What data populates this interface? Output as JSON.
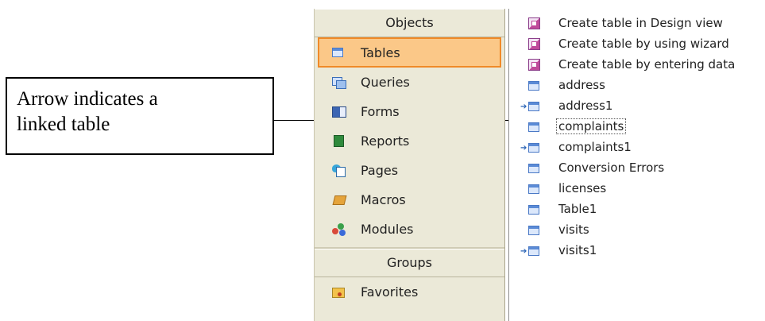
{
  "callout": {
    "line1": "Arrow indicates a",
    "line2": "linked table"
  },
  "objects_bar": {
    "objects_header": "Objects",
    "items": [
      {
        "label": "Tables",
        "icon": "table-icon",
        "selected": true
      },
      {
        "label": "Queries",
        "icon": "queries-icon"
      },
      {
        "label": "Forms",
        "icon": "forms-icon"
      },
      {
        "label": "Reports",
        "icon": "reports-icon"
      },
      {
        "label": "Pages",
        "icon": "pages-icon"
      },
      {
        "label": "Macros",
        "icon": "macros-icon"
      },
      {
        "label": "Modules",
        "icon": "modules-icon"
      }
    ],
    "groups_header": "Groups",
    "groups": [
      {
        "label": "Favorites",
        "icon": "favorites-folder-icon"
      }
    ]
  },
  "table_list": {
    "items": [
      {
        "label": "Create table in Design view",
        "icon": "wizard-icon",
        "linked": false
      },
      {
        "label": "Create table by using wizard",
        "icon": "wizard-icon",
        "linked": false
      },
      {
        "label": "Create table by entering data",
        "icon": "wizard-icon",
        "linked": false
      },
      {
        "label": "address",
        "icon": "table-icon",
        "linked": false
      },
      {
        "label": "address1",
        "icon": "table-icon",
        "linked": true
      },
      {
        "label": "complaints",
        "icon": "table-icon",
        "linked": false,
        "focused": true
      },
      {
        "label": "complaints1",
        "icon": "table-icon",
        "linked": true
      },
      {
        "label": "Conversion Errors",
        "icon": "table-icon",
        "linked": false
      },
      {
        "label": "licenses",
        "icon": "table-icon",
        "linked": false
      },
      {
        "label": "Table1",
        "icon": "table-icon",
        "linked": false
      },
      {
        "label": "visits",
        "icon": "table-icon",
        "linked": false
      },
      {
        "label": "visits1",
        "icon": "table-icon",
        "linked": true
      }
    ],
    "link_arrow_glyph": "➔"
  },
  "colors": {
    "selection_fill": "#fbc888",
    "selection_border": "#f08a28",
    "objects_bar_bg": "#ebe9d8",
    "link_arrow": "#2b64b6"
  }
}
